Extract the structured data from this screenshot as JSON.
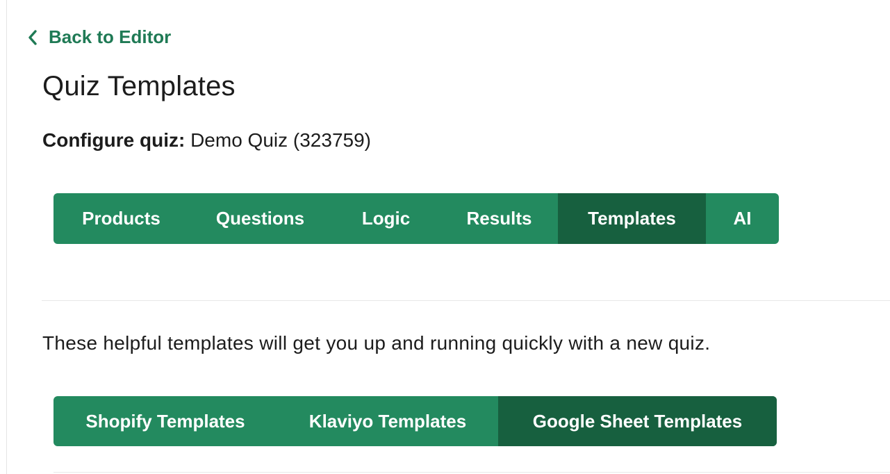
{
  "nav": {
    "back_label": "Back to Editor"
  },
  "page": {
    "title": "Quiz Templates",
    "configure_label": "Configure quiz:",
    "configure_value": "Demo Quiz (323759)",
    "intro": "These helpful templates will get you up and running quickly with a new quiz."
  },
  "main_tabs": {
    "active": "Templates",
    "items": [
      {
        "label": "Products"
      },
      {
        "label": "Questions"
      },
      {
        "label": "Logic"
      },
      {
        "label": "Results"
      },
      {
        "label": "Templates"
      },
      {
        "label": "AI"
      }
    ]
  },
  "template_tabs": {
    "active": "Google Sheet Templates",
    "items": [
      {
        "label": "Shopify Templates"
      },
      {
        "label": "Klaviyo Templates"
      },
      {
        "label": "Google Sheet Templates"
      }
    ]
  },
  "icons": {
    "back": "chevron-left-icon"
  },
  "colors": {
    "accent": "#1f7a55",
    "tab_bg": "#238a5f",
    "tab_active_bg": "#17603f",
    "tab_text": "#ffffff"
  }
}
